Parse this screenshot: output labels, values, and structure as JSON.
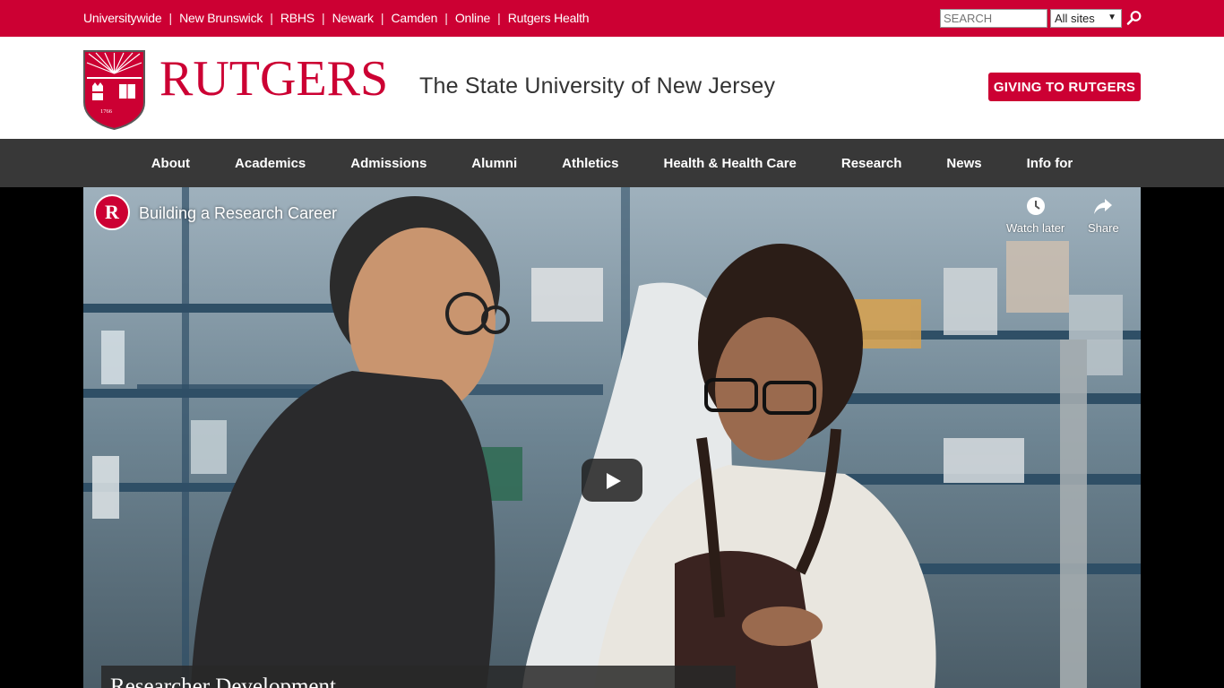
{
  "topbar": {
    "campus_links": [
      "Universitywide",
      "New Brunswick",
      "RBHS",
      "Newark",
      "Camden",
      "Online",
      "Rutgers Health"
    ],
    "separator": "|",
    "search_placeholder": "SEARCH",
    "site_select": "All sites",
    "accent_color": "#cc0033"
  },
  "header": {
    "wordmark": "RUTGERS",
    "seal_year": "1766",
    "tagline": "The State University of New Jersey",
    "giving_button": "GIVING TO RUTGERS"
  },
  "nav": {
    "items": [
      "About",
      "Academics",
      "Admissions",
      "Alumni",
      "Athletics",
      "Health & Health Care",
      "Research",
      "News",
      "Info for"
    ]
  },
  "video": {
    "channel_logo": "R",
    "title": "Building a Research Career",
    "watch_later": "Watch later",
    "share": "Share",
    "caption": "Researcher Development"
  }
}
